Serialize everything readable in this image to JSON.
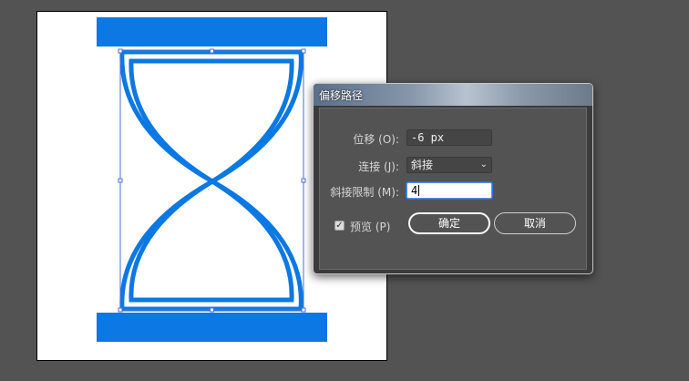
{
  "dialog": {
    "title": "偏移路径",
    "offset": {
      "label": "位移 (O):",
      "value": "-6 px"
    },
    "joins": {
      "label": "连接 (J):",
      "value": "斜接"
    },
    "miter_limit": {
      "label": "斜接限制 (M):",
      "value": "4"
    },
    "preview": {
      "label": "预览 (P)",
      "checked": true
    },
    "ok_label": "确定",
    "cancel_label": "取消"
  },
  "colors": {
    "shape_blue": "#0b78e3",
    "selection_blue": "#4a6fd8",
    "workspace_gray": "#535353",
    "dialog_panel": "#535353"
  },
  "icons": {
    "checkbox": "checkmark-icon",
    "dropdown": "chevron-down-icon"
  }
}
